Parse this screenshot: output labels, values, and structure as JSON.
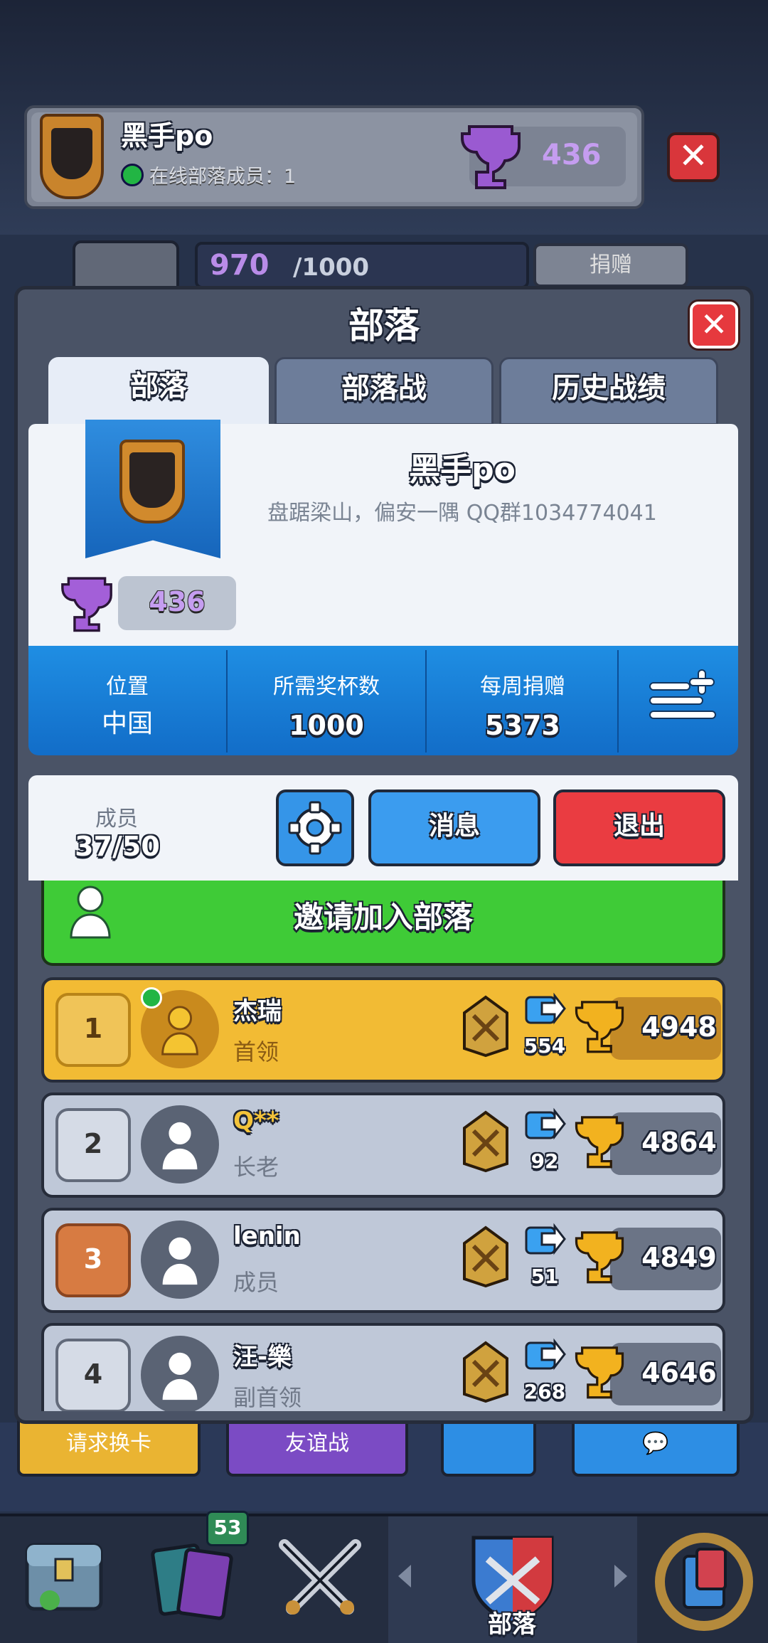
{
  "top_banner": {
    "clan_name": "黑手po",
    "online_text": "在线部落成员：1",
    "trophies": "436"
  },
  "progress": {
    "current": "970",
    "max": "/1000",
    "donate_label": "捐赠"
  },
  "panel": {
    "title": "部落",
    "tabs": [
      "部落",
      "部落战",
      "历史战绩"
    ],
    "clan_name": "黑手po",
    "description": "盘踞梁山，偏安一隅 QQ群1034774041",
    "trophies": "436",
    "stats": [
      {
        "label": "位置",
        "value": "中国"
      },
      {
        "label": "所需奖杯数",
        "value": "1000"
      },
      {
        "label": "每周捐赠",
        "value": "5373"
      }
    ],
    "members_label": "成员",
    "members_count": "37/50",
    "message_button": "消息",
    "quit_button": "退出",
    "invite_button": "邀请加入部落"
  },
  "members": [
    {
      "rank": "1",
      "name": "杰瑞",
      "role": "首领",
      "donations": "554",
      "trophies": "4948",
      "online": true
    },
    {
      "rank": "2",
      "name": "Q**",
      "role": "长老",
      "donations": "92",
      "trophies": "4864",
      "online": false
    },
    {
      "rank": "3",
      "name": "lenin",
      "role": "成员",
      "donations": "51",
      "trophies": "4849",
      "online": false
    },
    {
      "rank": "4",
      "name": "汪-樂",
      "role": "副首领",
      "donations": "268",
      "trophies": "4646",
      "online": false
    }
  ],
  "bottom_buttons": {
    "request": "请求换卡",
    "friendly": "友谊战"
  },
  "nav": {
    "cards_badge": "53",
    "active_label": "部落"
  },
  "colors": {
    "gold_row": "#f2bb34",
    "grey_row": "#bfc8d8",
    "stats_blue": "#1f8ee3",
    "invite_green": "#3fcb37",
    "quit_red": "#ea3c41",
    "trophy_purple": "#c59df0"
  }
}
